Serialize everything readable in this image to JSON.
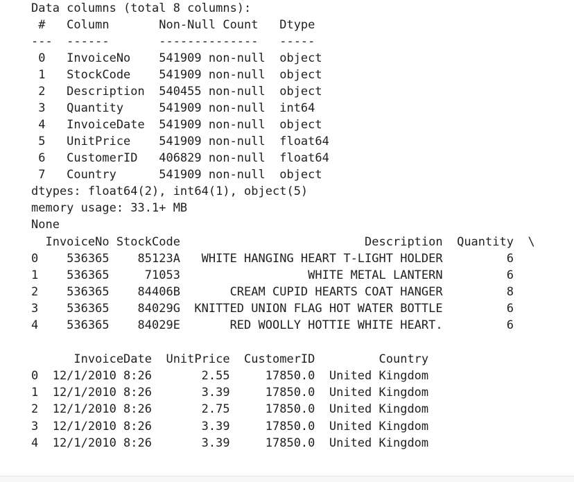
{
  "output": {
    "lines": [
      "Data columns (total 8 columns):",
      " #   Column       Non-Null Count   Dtype  ",
      "---  ------       --------------   -----  ",
      " 0   InvoiceNo    541909 non-null  object ",
      " 1   StockCode    541909 non-null  object ",
      " 2   Description  540455 non-null  object ",
      " 3   Quantity     541909 non-null  int64  ",
      " 4   InvoiceDate  541909 non-null  object ",
      " 5   UnitPrice    541909 non-null  float64",
      " 6   CustomerID   406829 non-null  float64",
      " 7   Country      541909 non-null  object ",
      "dtypes: float64(2), int64(1), object(5)",
      "memory usage: 33.1+ MB",
      "None",
      "  InvoiceNo StockCode                          Description  Quantity  \\",
      "0    536365    85123A   WHITE HANGING HEART T-LIGHT HOLDER         6   ",
      "1    536365     71053                  WHITE METAL LANTERN         6   ",
      "2    536365    84406B       CREAM CUPID HEARTS COAT HANGER         8   ",
      "3    536365    84029G  KNITTED UNION FLAG HOT WATER BOTTLE         6   ",
      "4    536365    84029E       RED WOOLLY HOTTIE WHITE HEART.         6   ",
      "",
      "      InvoiceDate  UnitPrice  CustomerID         Country  ",
      "0  12/1/2010 8:26       2.55     17850.0  United Kingdom  ",
      "1  12/1/2010 8:26       3.39     17850.0  United Kingdom  ",
      "2  12/1/2010 8:26       2.75     17850.0  United Kingdom  ",
      "3  12/1/2010 8:26       3.39     17850.0  United Kingdom  ",
      "4  12/1/2010 8:26       3.39     17850.0  United Kingdom  "
    ]
  }
}
